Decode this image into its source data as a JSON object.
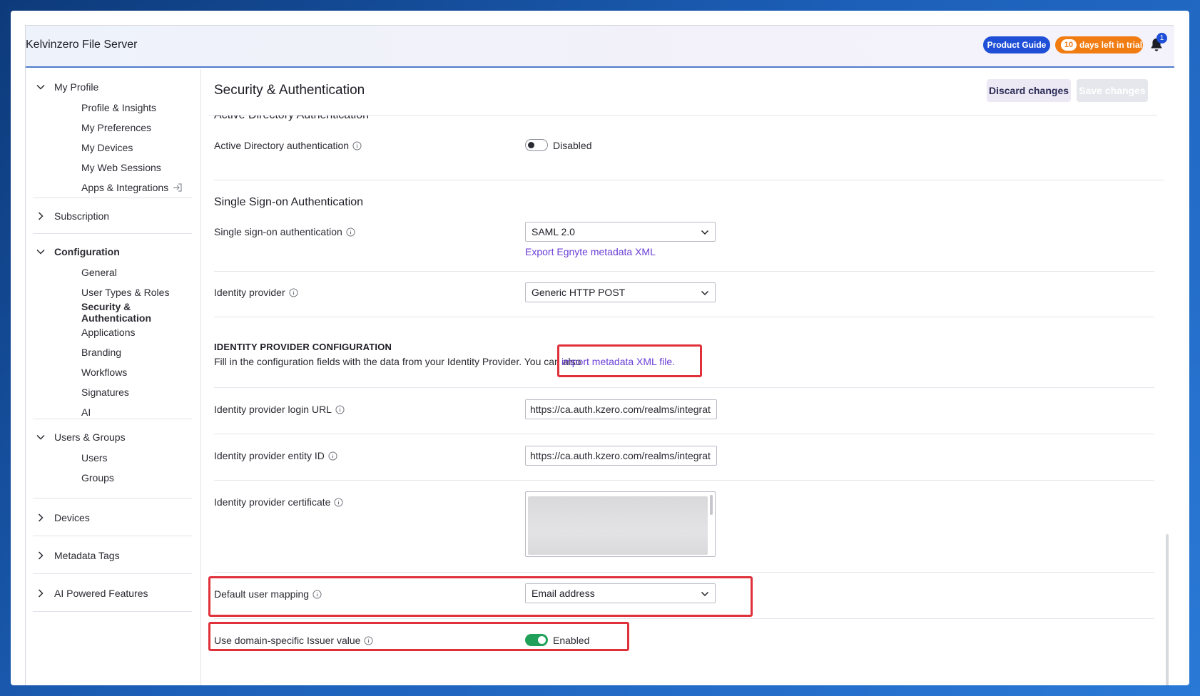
{
  "header": {
    "app_title": "Kelvinzero File Server",
    "product_guide": "Product Guide",
    "trial_count": "10",
    "trial_text": "days left in trial",
    "notification_count": "1"
  },
  "sidebar": {
    "my_profile": {
      "label": "My Profile",
      "items": [
        "Profile & Insights",
        "My Preferences",
        "My Devices",
        "My Web Sessions",
        "Apps & Integrations"
      ]
    },
    "subscription": {
      "label": "Subscription"
    },
    "configuration": {
      "label": "Configuration",
      "items": [
        "General",
        "User Types & Roles",
        "Security & Authentication",
        "Applications",
        "Branding",
        "Workflows",
        "Signatures",
        "AI"
      ]
    },
    "users_groups": {
      "label": "Users & Groups",
      "items": [
        "Users",
        "Groups"
      ]
    },
    "devices": {
      "label": "Devices"
    },
    "metadata_tags": {
      "label": "Metadata Tags"
    },
    "ai_features": {
      "label": "AI Powered Features"
    }
  },
  "main": {
    "title": "Security & Authentication",
    "discard": "Discard changes",
    "save": "Save changes",
    "ad_section_title": "Active Directory Authentication",
    "ad_label": "Active Directory authentication",
    "ad_state": "Disabled",
    "sso_title": "Single Sign-on Authentication",
    "sso_label": "Single sign-on authentication",
    "sso_value": "SAML 2.0",
    "export_link": "Export Egnyte metadata XML",
    "idp_label": "Identity provider",
    "idp_value": "Generic HTTP POST",
    "idp_config_title": "IDENTITY PROVIDER CONFIGURATION",
    "idp_config_desc": "Fill in the configuration fields with the data from your Identity Provider. You can also",
    "import_link": "import metadata XML file.",
    "login_url_label": "Identity provider login URL",
    "login_url_value": "https://ca.auth.kzero.com/realms/integrat",
    "entity_id_label": "Identity provider entity ID",
    "entity_id_value": "https://ca.auth.kzero.com/realms/integrat",
    "cert_label": "Identity provider certificate",
    "mapping_label": "Default user mapping",
    "mapping_value": "Email address",
    "issuer_label": "Use domain-specific Issuer value",
    "issuer_state": "Enabled"
  },
  "colors": {
    "accent": "#1f4fd6",
    "trial": "#f07c12",
    "link": "#6b3fd6",
    "enabled": "#21a05a",
    "highlight": "#e0313b"
  }
}
